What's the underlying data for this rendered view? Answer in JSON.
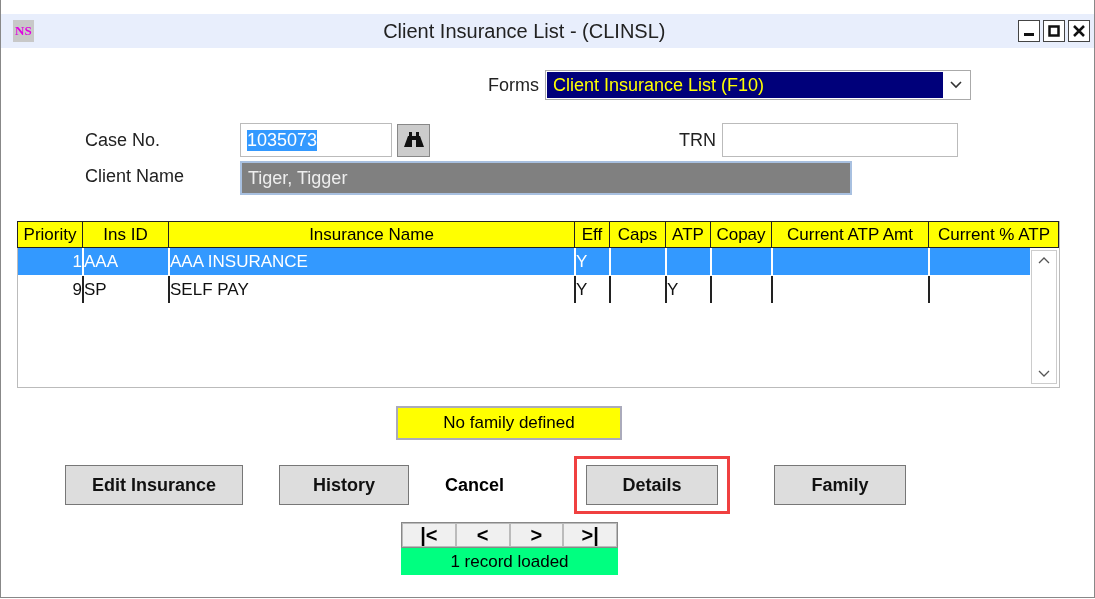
{
  "window": {
    "logo": "NS",
    "title": "Client Insurance List - (CLINSL)"
  },
  "forms": {
    "label": "Forms",
    "value": "Client Insurance List (F10)"
  },
  "case_no": {
    "label": "Case No.",
    "value": "1035073",
    "selected": true
  },
  "trn": {
    "label": "TRN"
  },
  "client_name": {
    "label": "Client Name",
    "value": "Tiger, Tigger"
  },
  "table": {
    "columns": [
      "Priority",
      "Ins ID",
      "Insurance Name",
      "Eff",
      "Caps",
      "ATP",
      "Copay",
      "Current ATP Amt",
      "Current % ATP"
    ],
    "rows": [
      {
        "selected": true,
        "cells": [
          "1",
          "AAA",
          "AAA INSURANCE",
          "Y",
          "",
          "",
          "",
          "",
          ""
        ]
      },
      {
        "selected": false,
        "cells": [
          "9",
          "SP",
          "SELF PAY",
          "Y",
          "",
          "Y",
          "",
          "",
          ""
        ]
      }
    ]
  },
  "family_status": "No family defined",
  "buttons": [
    {
      "kind": "button",
      "label": "Edit Insurance",
      "highlighted": false
    },
    {
      "kind": "button",
      "label": "History",
      "highlighted": false
    },
    {
      "kind": "plain",
      "label": "Cancel",
      "highlighted": false
    },
    {
      "kind": "button",
      "label": "Details",
      "highlighted": true
    },
    {
      "kind": "button",
      "label": "Family",
      "highlighted": false
    }
  ],
  "navigator": {
    "buttons": [
      "|<",
      "<",
      ">",
      ">|"
    ],
    "status": "1 record loaded"
  }
}
